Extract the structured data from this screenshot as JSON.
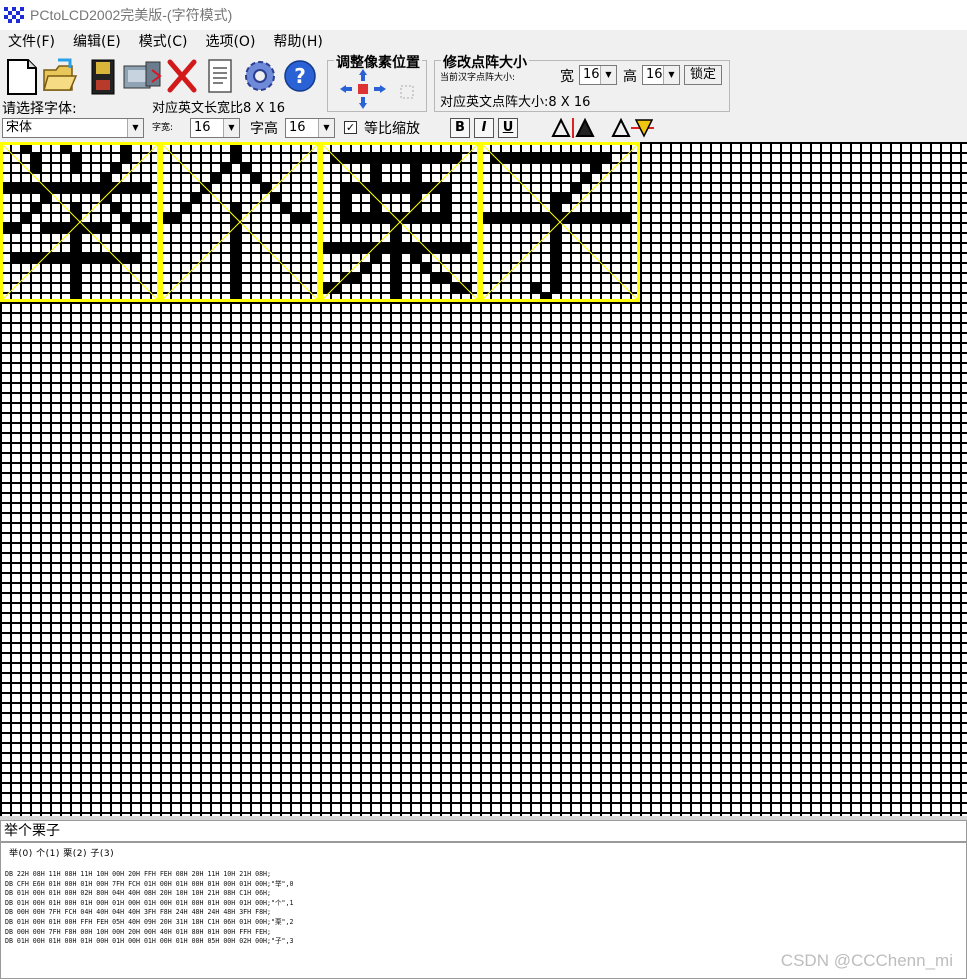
{
  "window": {
    "title": "PCtoLCD2002完美版-(字符模式)"
  },
  "menu": [
    "文件(F)",
    "编辑(E)",
    "模式(C)",
    "选项(O)",
    "帮助(H)"
  ],
  "toolbar": {
    "icons": [
      "new-file-icon",
      "open-folder-icon",
      "save-disk-icon",
      "export-icon",
      "delete-icon",
      "notes-icon",
      "settings-gear-icon",
      "help-icon"
    ],
    "adjust_group_title": "调整像素位置",
    "resize_group_title": "修改点阵大小",
    "current_chinese_size_label": "当前汉字点阵大小:",
    "width_label": "宽",
    "width_value": "16",
    "height_label": "高",
    "height_value": "16",
    "lock_button": "锁定",
    "english_size_label": "对应英文点阵大小:8 X 16",
    "select_font_label": "请选择字体:",
    "english_ratio_label": "对应英文长宽比8 X 16",
    "font_value": "宋体",
    "char_width_label": "字宽:",
    "char_width_value": "16",
    "char_height_label": "字高",
    "char_height_value": "16",
    "proportional_label": "等比缩放",
    "proportional_checked": "✓",
    "bold": "B",
    "italic": "I",
    "underline": "U"
  },
  "glyph_colors": {
    "pixel": "#000000",
    "frame": "#ffff00"
  },
  "input_text": "举个栗子",
  "output": {
    "header": "举(0) 个(1) 栗(2) 子(3)",
    "lines": [
      "DB 22H 08H 11H 08H 11H 10H 00H 20H FFH FEH 08H 20H 11H 10H 21H 08H;",
      "DB CFH E6H 01H 00H 01H 00H 7FH FCH 01H 00H 01H 00H 01H 00H 01H 00H;\"举\",0",
      "DB 01H 00H 01H 00H 02H 80H 04H 40H 08H 20H 10H 10H 21H 08H C1H 06H;",
      "DB 01H 00H 01H 00H 01H 00H 01H 00H 01H 00H 01H 00H 01H 00H 01H 00H;\"个\",1",
      "DB 00H 00H 7FH FCH 04H 40H 04H 40H 3FH F8H 24H 48H 24H 48H 3FH F8H;",
      "DB 01H 00H 01H 00H FFH FEH 05H 40H 09H 20H 31H 18H C1H 06H 01H 00H;\"栗\",2",
      "DB 00H 00H 7FH F8H 00H 10H 00H 20H 00H 40H 01H 80H 01H 00H FFH FEH;",
      "DB 01H 00H 01H 00H 01H 00H 01H 00H 01H 00H 01H 00H 05H 00H 02H 00H;\"子\",3"
    ]
  },
  "watermark": "CSDN @CCChenn_mi"
}
